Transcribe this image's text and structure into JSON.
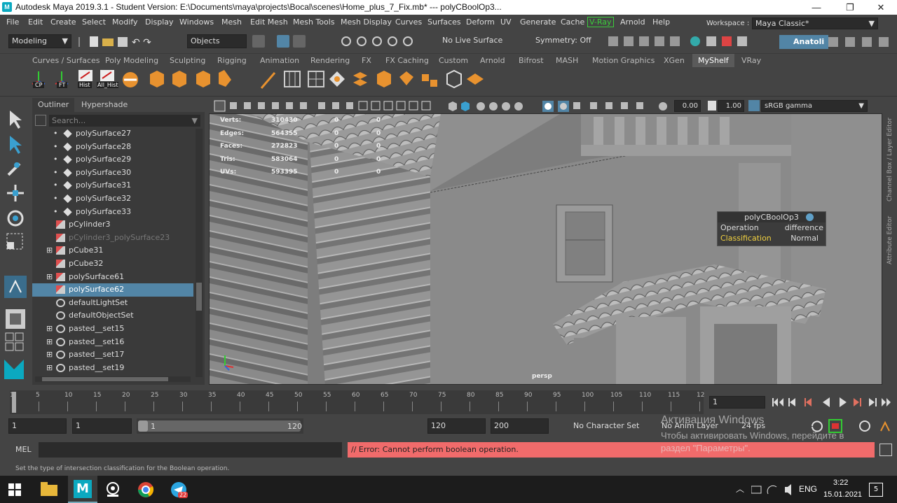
{
  "window": {
    "title": "Autodesk Maya 2019.3.1 - Student Version: E:\\Documents\\maya\\projects\\Bocal\\scenes\\Home_plus_7_Fix.mb*  ---  polyCBoolOp3...",
    "min": "—",
    "max": "❐",
    "close": "✕"
  },
  "menu": [
    "File",
    "Edit",
    "Create",
    "Select",
    "Modify",
    "Display",
    "Windows",
    "Mesh",
    "Edit Mesh",
    "Mesh Tools",
    "Mesh Display",
    "Curves",
    "Surfaces",
    "Deform",
    "UV",
    "Generate",
    "Cache",
    "V-Ray",
    "Arnold",
    "Help"
  ],
  "workspace": {
    "label": "Workspace :",
    "value": "Maya Classic*"
  },
  "status": {
    "mode": "Modeling",
    "objects": "Objects",
    "live_surface": "No Live Surface",
    "symmetry": "Symmetry: Off",
    "user": "Anatoli"
  },
  "shelf_tabs": [
    "Curves / Surfaces",
    "Poly Modeling",
    "Sculpting",
    "Rigging",
    "Animation",
    "Rendering",
    "FX",
    "FX Caching",
    "Custom",
    "Arnold",
    "Bifrost",
    "MASH",
    "Motion Graphics",
    "XGen",
    "MyShelf",
    "VRay"
  ],
  "shelf_active": "MyShelf",
  "shelf_labels": [
    "CP",
    "FT",
    "Hist",
    "All_Hist"
  ],
  "outliner": {
    "tab1": "Outliner",
    "tab2": "Hypershade",
    "search_placeholder": "Search...",
    "rows": [
      {
        "label": "polySurface27",
        "indent": 2,
        "kind": "mesh"
      },
      {
        "label": "polySurface28",
        "indent": 2,
        "kind": "mesh"
      },
      {
        "label": "polySurface29",
        "indent": 2,
        "kind": "mesh"
      },
      {
        "label": "polySurface30",
        "indent": 2,
        "kind": "mesh"
      },
      {
        "label": "polySurface31",
        "indent": 2,
        "kind": "mesh"
      },
      {
        "label": "polySurface32",
        "indent": 2,
        "kind": "mesh"
      },
      {
        "label": "polySurface33",
        "indent": 2,
        "kind": "mesh"
      },
      {
        "label": "pCylinder3",
        "indent": 1,
        "kind": "mesh"
      },
      {
        "label": "pCylinder3_polySurface23",
        "indent": 1,
        "kind": "mesh",
        "dim": true
      },
      {
        "label": "pCube31",
        "indent": 1,
        "kind": "mesh",
        "expand": true
      },
      {
        "label": "pCube32",
        "indent": 1,
        "kind": "mesh"
      },
      {
        "label": "polySurface61",
        "indent": 1,
        "kind": "mesh",
        "expand": true
      },
      {
        "label": "polySurface62",
        "indent": 1,
        "kind": "mesh",
        "selected": true
      },
      {
        "label": "defaultLightSet",
        "indent": 1,
        "kind": "set"
      },
      {
        "label": "defaultObjectSet",
        "indent": 1,
        "kind": "set"
      },
      {
        "label": "pasted__set15",
        "indent": 1,
        "kind": "set",
        "expand": true
      },
      {
        "label": "pasted__set16",
        "indent": 1,
        "kind": "set",
        "expand": true
      },
      {
        "label": "pasted__set17",
        "indent": 1,
        "kind": "set",
        "expand": true
      },
      {
        "label": "pasted__set19",
        "indent": 1,
        "kind": "set",
        "expand": true
      }
    ]
  },
  "viewport": {
    "field1": "0.00",
    "field2": "1.00",
    "color_space": "sRGB gamma",
    "camera": "persp",
    "hud": [
      {
        "k": "Verts:",
        "a": "310430",
        "b": "0",
        "c": "0"
      },
      {
        "k": "Edges:",
        "a": "564355",
        "b": "0",
        "c": "0"
      },
      {
        "k": "Faces:",
        "a": "272823",
        "b": "0",
        "c": "0"
      },
      {
        "k": "Tris:",
        "a": "583064",
        "b": "0",
        "c": "0"
      },
      {
        "k": "UVs:",
        "a": "593395",
        "b": "0",
        "c": "0"
      }
    ]
  },
  "bool_popup": {
    "title": "polyCBoolOp3",
    "op_label": "Operation",
    "op_value": "difference",
    "class_label": "Classification",
    "class_value": "Normal"
  },
  "side_tabs": [
    "Channel Box / Layer Editor",
    "Attribute Editor"
  ],
  "timeline": {
    "ticks": [
      "1",
      "5",
      "10",
      "15",
      "20",
      "25",
      "30",
      "35",
      "40",
      "45",
      "50",
      "55",
      "60",
      "65",
      "70",
      "75",
      "80",
      "85",
      "90",
      "95",
      "100",
      "105",
      "110",
      "115",
      "12"
    ],
    "current_frame": "1"
  },
  "range": {
    "start": "1",
    "start2": "1",
    "slider_start": "1",
    "slider_end": "120",
    "end": "120",
    "end2": "200",
    "character": "No Character Set",
    "anim_layer": "No Anim Layer",
    "fps": "24 fps"
  },
  "cmd": {
    "label": "MEL",
    "error": "// Error: Cannot perform boolean operation."
  },
  "activation": {
    "line1": "Активация Windows",
    "line2": "Чтобы активировать Windows, перейдите в",
    "line3": "раздел \"Параметры\"."
  },
  "help_text": "Set the type of intersection classification for the Boolean operation.",
  "taskbar": {
    "lang": "ENG",
    "time": "3:22",
    "date": "15.01.2021",
    "badge": "22",
    "notif": "5"
  }
}
